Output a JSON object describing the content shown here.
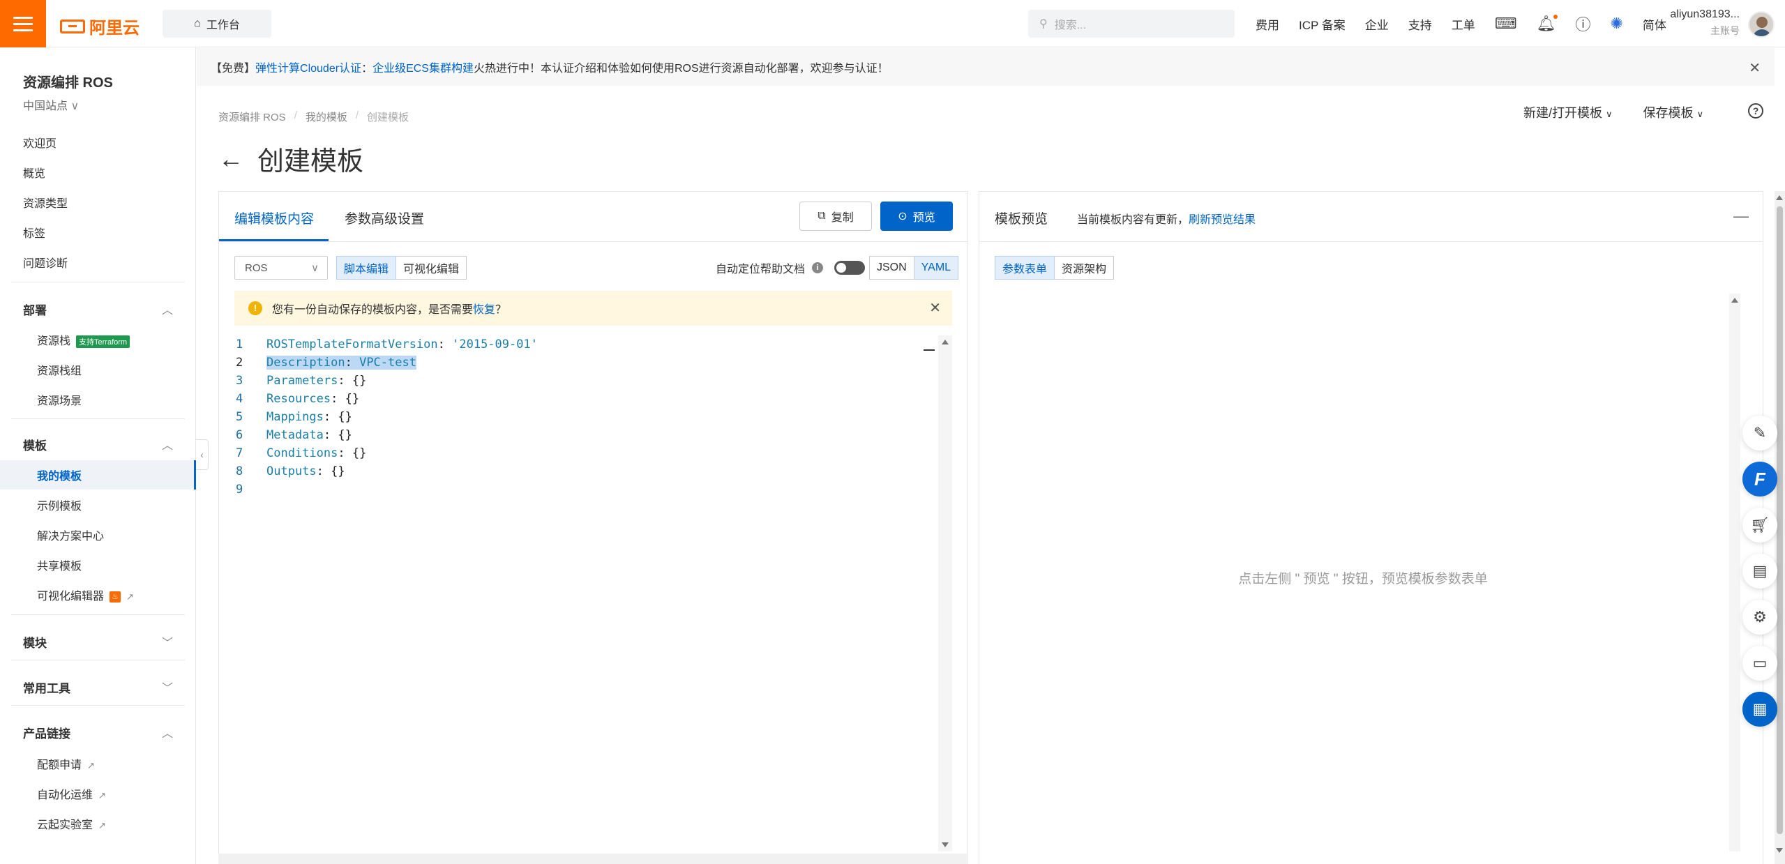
{
  "topbar": {
    "logo_text": "阿里云",
    "workbench": "工作台",
    "search_placeholder": "搜索...",
    "nav": [
      "费用",
      "ICP 备案",
      "企业",
      "支持",
      "工单"
    ],
    "lang": "简体",
    "user_name": "aliyun38193...",
    "user_role": "主账号"
  },
  "sidebar": {
    "title": "资源编排 ROS",
    "region": "中国站点",
    "top_items": [
      "欢迎页",
      "概览",
      "资源类型",
      "标签",
      "问题诊断"
    ],
    "deploy": {
      "label": "部署",
      "items": [
        "资源栈",
        "资源栈组",
        "资源场景"
      ],
      "badge": "支持Terraform"
    },
    "template": {
      "label": "模板",
      "items": [
        "我的模板",
        "示例模板",
        "解决方案中心",
        "共享模板",
        "可视化编辑器"
      ]
    },
    "module": {
      "label": "模块"
    },
    "tools": {
      "label": "常用工具"
    },
    "links": {
      "label": "产品链接",
      "items": [
        "配额申请",
        "自动化运维",
        "云起实验室"
      ]
    }
  },
  "banner": {
    "prefix": "【免费】",
    "link1": "弹性计算Clouder认证",
    "mid": "：",
    "link2": "企业级ECS集群构建",
    "suffix": "火热进行中！本认证介绍和体验如何使用ROS进行资源自动化部署，欢迎参与认证！"
  },
  "breadcrumb": [
    "资源编排 ROS",
    "我的模板",
    "创建模板"
  ],
  "page": {
    "title": "创建模板",
    "action_new": "新建/打开模板",
    "action_save": "保存模板"
  },
  "left_panel": {
    "tab_edit": "编辑模板内容",
    "tab_params": "参数高级设置",
    "btn_copy": "复制",
    "btn_preview": "预览",
    "select_value": "ROS",
    "mode_script": "脚本编辑",
    "mode_visual": "可视化编辑",
    "auto_locate": "自动定位帮助文档",
    "fmt_json": "JSON",
    "fmt_yaml": "YAML",
    "warn_text": "您有一份自动保存的模板内容，是否需要",
    "warn_link": "恢复",
    "warn_q": "？",
    "code": [
      {
        "n": "1",
        "key": "ROSTemplateFormatVersion",
        "val": "'2015-09-01'"
      },
      {
        "n": "2",
        "key": "Description",
        "val": "VPC-test"
      },
      {
        "n": "3",
        "key": "Parameters",
        "val": "{}"
      },
      {
        "n": "4",
        "key": "Resources",
        "val": "{}"
      },
      {
        "n": "5",
        "key": "Mappings",
        "val": "{}"
      },
      {
        "n": "6",
        "key": "Metadata",
        "val": "{}"
      },
      {
        "n": "7",
        "key": "Conditions",
        "val": "{}"
      },
      {
        "n": "8",
        "key": "Outputs",
        "val": "{}"
      },
      {
        "n": "9",
        "key": "",
        "val": ""
      }
    ]
  },
  "right_panel": {
    "title": "模板预览",
    "hint": "当前模板内容有更新，",
    "hint_link": "刷新预览结果",
    "tab_params": "参数表单",
    "tab_arch": "资源架构",
    "empty": "点击左侧 \" 预览 \" 按钮，预览模板参数表单"
  },
  "float_icons": [
    "edit-icon",
    "f-logo-icon",
    "cart-icon",
    "document-icon",
    "settings-icon",
    "chat-icon",
    "apps-icon"
  ]
}
